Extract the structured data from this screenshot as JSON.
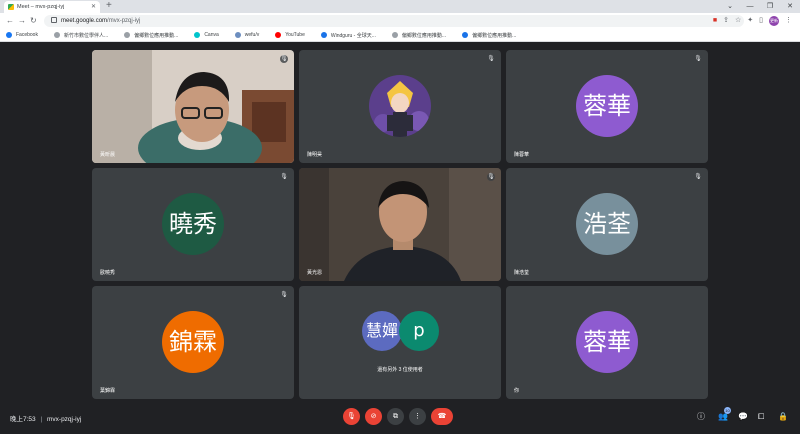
{
  "browser": {
    "tab_title": "Meet – mvx-pzqj-iyj",
    "new_tab": "+",
    "url_host": "meet.google.com",
    "url_path": "/mvx-pzqj-iyj",
    "window_controls": [
      "⌄",
      "—",
      "❐",
      "✕"
    ]
  },
  "bookmarks": [
    {
      "label": "Facebook",
      "color": "#1877f2"
    },
    {
      "label": "新竹市數位學伴人...",
      "color": "#9aa0a6"
    },
    {
      "label": "偏鄉數位應用推動...",
      "color": "#9aa0a6"
    },
    {
      "label": "Canva",
      "color": "#00c4cc"
    },
    {
      "label": "wefu/v",
      "color": "#6c8ebf"
    },
    {
      "label": "YouTube",
      "color": "#ff0000"
    },
    {
      "label": "Windguru - 全球天...",
      "color": "#1a73e8"
    },
    {
      "label": "偏鄉數位應用推動...",
      "color": "#9aa0a6"
    },
    {
      "label": "偏鄉數位應用推動...",
      "color": "#1a73e8"
    }
  ],
  "profile_label": "更新",
  "tiles": [
    {
      "name": "黃昕晨",
      "type": "video"
    },
    {
      "name": "陳明昊",
      "type": "image"
    },
    {
      "name": "陳蓉華",
      "avatar": "蓉華",
      "color": "#8e5bd0"
    },
    {
      "name": "歐曉秀",
      "avatar": "曉秀",
      "color": "#1e5a43"
    },
    {
      "name": "黃光恩",
      "type": "video"
    },
    {
      "name": "陳浩荃",
      "avatar": "浩荃",
      "color": "#78909c"
    },
    {
      "name": "葉錦霖",
      "avatar": "錦霖",
      "color": "#ef6c00"
    },
    {
      "name": "還有另外 3 位使用者",
      "avatars": [
        "慧嬋",
        "p"
      ],
      "colors": [
        "#5c6bc0",
        "#0b8a6f"
      ]
    },
    {
      "name": "你",
      "avatar": "蓉華",
      "color": "#8e5bd0"
    }
  ],
  "bottom": {
    "time": "晚上7:53",
    "separator": "|",
    "meeting_code": "mvx-pzqj-iyj",
    "participant_count": "10"
  }
}
